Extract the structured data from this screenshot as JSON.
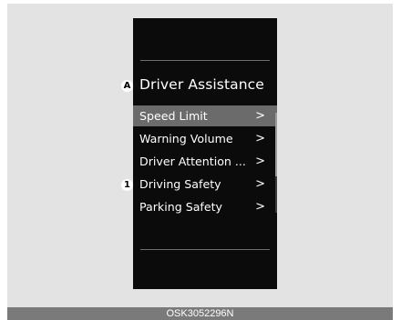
{
  "screen": {
    "title": "Driver Assistance",
    "menu": [
      {
        "label": "Speed Limit",
        "chevron": ">"
      },
      {
        "label": "Warning Volume",
        "chevron": ">"
      },
      {
        "label": "Driver Attention ...",
        "chevron": ">"
      },
      {
        "label": "Driving Safety",
        "chevron": ">"
      },
      {
        "label": "Parking Safety",
        "chevron": ">"
      }
    ],
    "selected_item": "Speed Limit"
  },
  "callouts": {
    "a": "A",
    "one": "1"
  },
  "caption": "OSK3052296N",
  "colors": {
    "screen_bg": "#0b0b0b",
    "selected_bg": "#6b6b6b",
    "frame_bg": "#e3e3e3",
    "caption_bg": "#7a7a7a"
  },
  "icons": [
    "chevron-right-icon",
    "scrollbar"
  ]
}
